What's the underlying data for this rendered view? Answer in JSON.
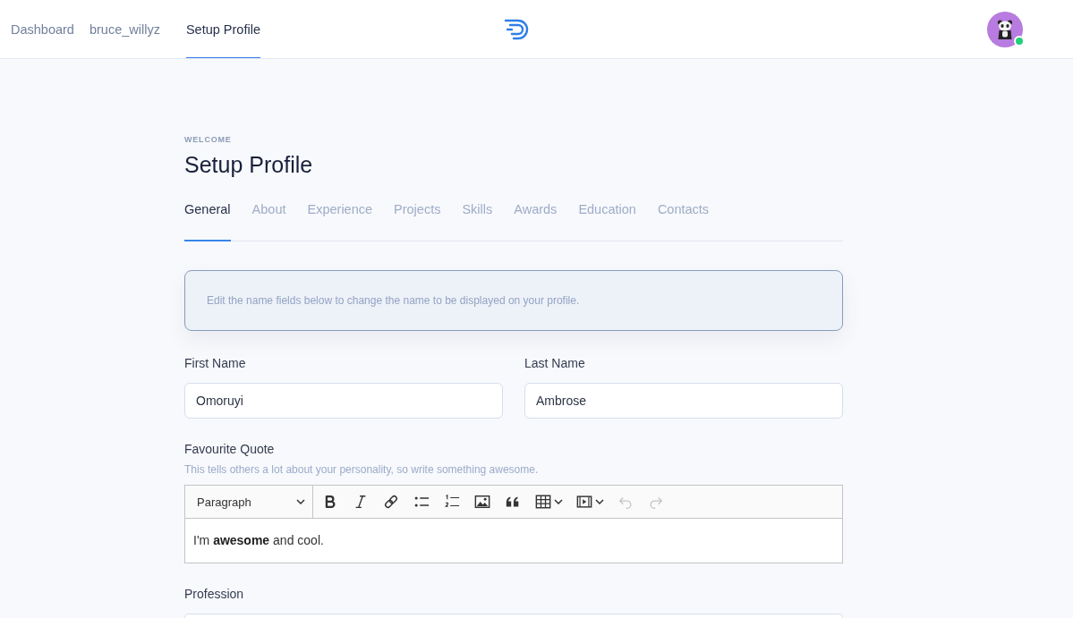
{
  "header": {
    "nav": [
      {
        "label": "Dashboard",
        "selected": false
      },
      {
        "label": "bruce_willyz",
        "selected": false
      },
      {
        "label": "Setup Profile",
        "selected": true
      }
    ],
    "user": {
      "online": true
    }
  },
  "page": {
    "eyebrow": "WELCOME",
    "title": "Setup Profile",
    "tabs": [
      {
        "label": "General",
        "selected": true
      },
      {
        "label": "About",
        "selected": false
      },
      {
        "label": "Experience",
        "selected": false
      },
      {
        "label": "Projects",
        "selected": false
      },
      {
        "label": "Skills",
        "selected": false
      },
      {
        "label": "Awards",
        "selected": false
      },
      {
        "label": "Education",
        "selected": false
      },
      {
        "label": "Contacts",
        "selected": false
      }
    ]
  },
  "notice": "Edit the name fields below to change the name to be displayed on your profile.",
  "name_fields": [
    {
      "label": "First Name",
      "value": "Omoruyi"
    },
    {
      "label": "Last Name",
      "value": "Ambrose"
    }
  ],
  "quote": {
    "label": "Favourite Quote",
    "help": "This tells others a lot about your personality, so write something awesome.",
    "format": "Paragraph",
    "toolbar": [
      {
        "kind": "bold",
        "disabled": false
      },
      {
        "kind": "italic",
        "disabled": false
      },
      {
        "kind": "link",
        "disabled": false
      },
      {
        "kind": "bulleted-list",
        "disabled": false
      },
      {
        "kind": "numbered-list",
        "disabled": false
      },
      {
        "kind": "image",
        "disabled": false
      },
      {
        "kind": "quote",
        "disabled": false
      },
      {
        "kind": "table",
        "disabled": false
      },
      {
        "kind": "media",
        "disabled": false
      },
      {
        "kind": "undo",
        "disabled": true
      },
      {
        "kind": "redo",
        "disabled": true
      }
    ],
    "content": "I'm **awesome** and cool."
  },
  "profession": {
    "label": "Profession"
  }
}
